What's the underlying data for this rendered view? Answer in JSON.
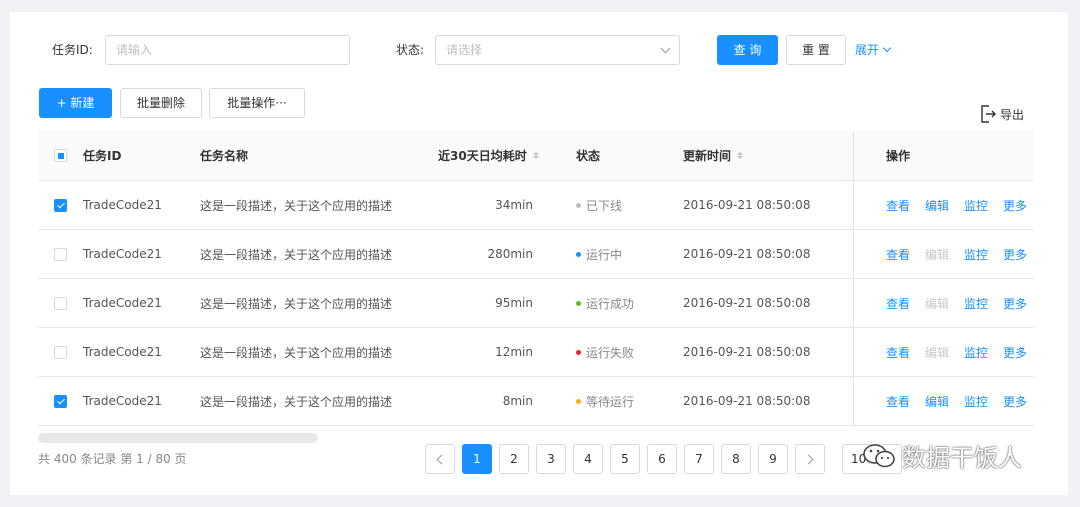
{
  "filters": {
    "task_id_label": "任务ID:",
    "task_id_placeholder": "请输入",
    "status_label": "状态:",
    "status_placeholder": "请选择",
    "query_label": "查 询",
    "reset_label": "重 置",
    "expand_label": "展开"
  },
  "toolbar": {
    "new_label": "+ 新建",
    "batch_delete_label": "批量删除",
    "batch_ops_label": "批量操作···",
    "export_label": "导出"
  },
  "table": {
    "columns": {
      "id": "任务ID",
      "name": "任务名称",
      "avg_time": "近30天日均耗时",
      "status": "状态",
      "updated": "更新时间",
      "ops": "操作"
    },
    "rows": [
      {
        "id": "TradeCode21",
        "name": "这是一段描述，关于这个应用的描述",
        "time": "34min",
        "status": "已下线",
        "updated": "2016-09-21  08:50:08",
        "checked": true
      },
      {
        "id": "TradeCode21",
        "name": "这是一段描述，关于这个应用的描述",
        "time": "280min",
        "status": "运行中",
        "updated": "2016-09-21  08:50:08",
        "checked": false
      },
      {
        "id": "TradeCode21",
        "name": "这是一段描述，关于这个应用的描述",
        "time": "95min",
        "status": "运行成功",
        "updated": "2016-09-21  08:50:08",
        "checked": false
      },
      {
        "id": "TradeCode21",
        "name": "这是一段描述，关于这个应用的描述",
        "time": "12min",
        "status": "运行失败",
        "updated": "2016-09-21  08:50:08",
        "checked": false
      },
      {
        "id": "TradeCode21",
        "name": "这是一段描述，关于这个应用的描述",
        "time": "8min",
        "status": "等待运行",
        "updated": "2016-09-21  08:50:08",
        "checked": true
      }
    ],
    "ops": {
      "view": "查看",
      "edit": "编辑",
      "monitor": "监控",
      "more": "更多"
    }
  },
  "status_colors": {
    "offline": "#bfbfbf",
    "running": "#1890ff",
    "success": "#52c41a",
    "failed": "#f5222d",
    "waiting": "#faad14"
  },
  "pagination": {
    "total_text": "共 400 条记录 第 1 / 80 页",
    "pages": [
      "1",
      "2",
      "3",
      "4",
      "5",
      "6",
      "7",
      "8",
      "9"
    ],
    "page_size": "10"
  },
  "watermark": {
    "text": "数据干饭人"
  }
}
